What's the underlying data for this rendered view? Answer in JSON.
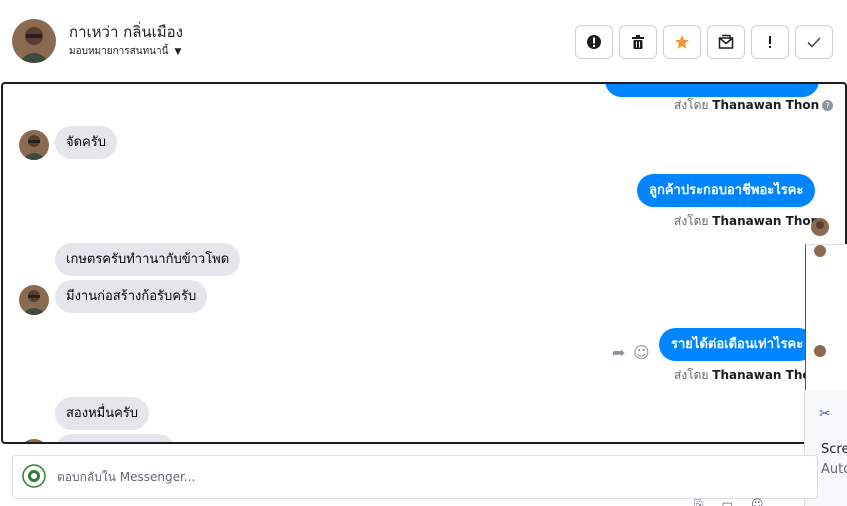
{
  "header": {
    "contact_name": "กาเหว่า กลิ่นเมือง",
    "assign_label": "มอบหมายการสนทนานี้",
    "actions": [
      {
        "name": "spam",
        "icon": "alert-icon"
      },
      {
        "name": "delete",
        "icon": "trash-icon"
      },
      {
        "name": "star",
        "icon": "star-icon"
      },
      {
        "name": "mark-unread",
        "icon": "envelope-icon"
      },
      {
        "name": "follow-up",
        "icon": "exclamation-icon"
      },
      {
        "name": "done",
        "icon": "check-icon"
      }
    ]
  },
  "messages": {
    "m1_sent_by_prefix": "ส่งโดย",
    "m1_sent_by_name": "Thanawan Thon",
    "m2_text": "จัดครับ",
    "m3_text": "ลูกค้าประกอบอาชีพอะไรคะ",
    "m3_sent_by_prefix": "ส่งโดย",
    "m3_sent_by_name": "Thanawan Thon",
    "m4_text": "เกษตรครับทำานากับข้าวโพด",
    "m5_text": "มีงานก่อสร้างก้อรับครับ",
    "m6_text": "รายได้ต่อเดือนเท่าไรคะ",
    "m6_sent_by_prefix": "ส่งโดย",
    "m6_sent_by_name": "Thanawan Thon",
    "m7_text": "สองหมื่นครับ"
  },
  "side_card": {
    "line1": "Scre",
    "line2": "Auto"
  },
  "reply": {
    "placeholder": "ตอบกลับใน Messenger..."
  },
  "colors": {
    "outgoing_bubble": "#0084ff",
    "incoming_bubble": "#e4e6eb",
    "star_accent": "#f7923b"
  }
}
